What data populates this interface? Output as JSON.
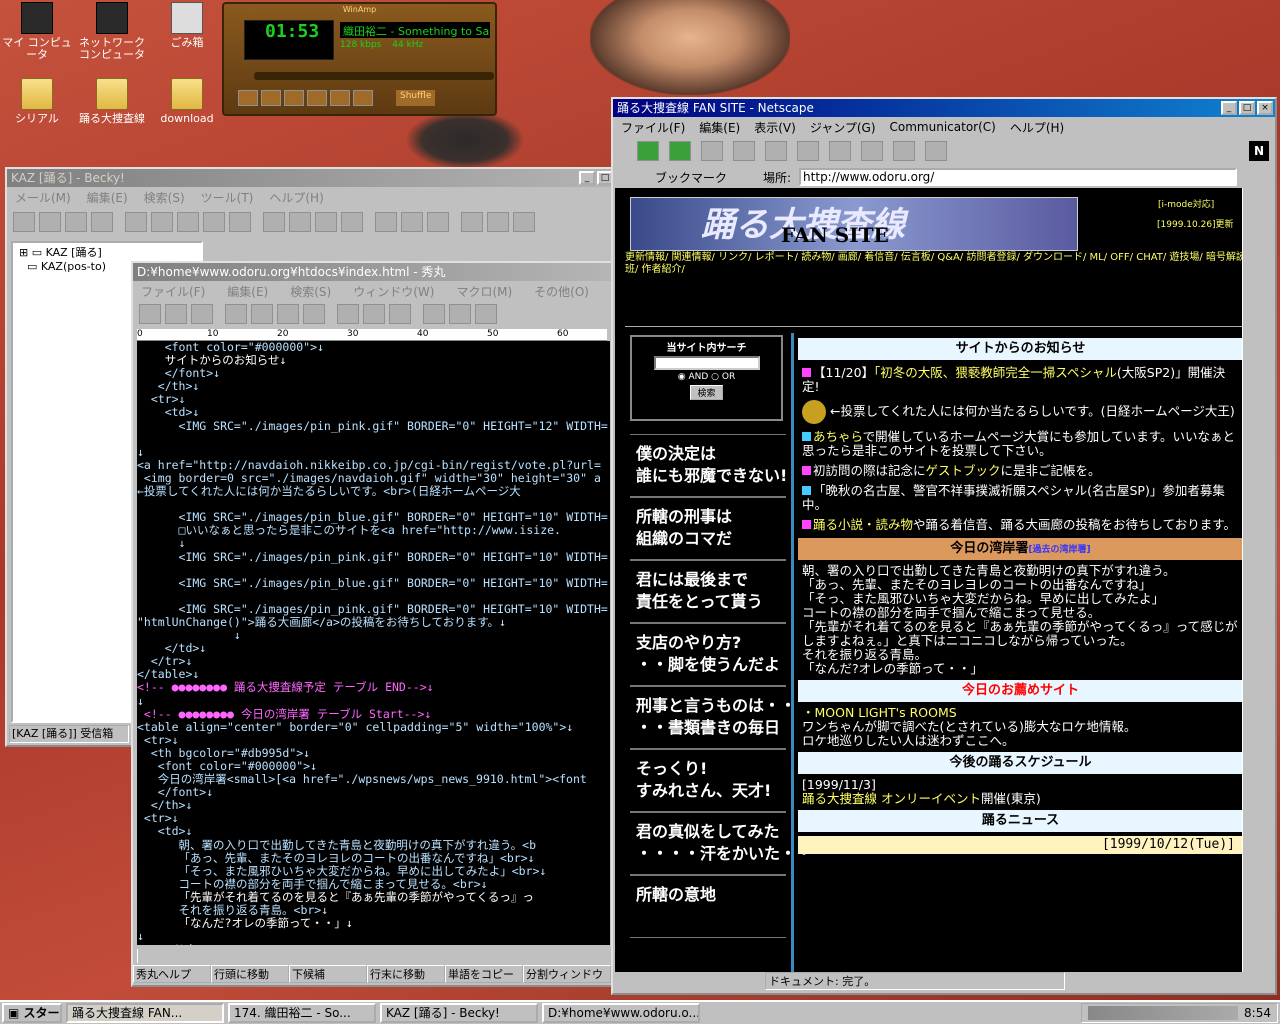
{
  "desktop": {
    "icons": [
      {
        "label": "マイ コンピュータ",
        "kind": "pc"
      },
      {
        "label": "ネットワーク コンピュータ",
        "kind": "pc"
      },
      {
        "label": "ごみ箱",
        "kind": "trash"
      },
      {
        "label": "シリアル",
        "kind": "folder"
      },
      {
        "label": "踊る大捜査線",
        "kind": "folder"
      },
      {
        "label": "download",
        "kind": "folder"
      }
    ]
  },
  "winamp": {
    "title": "WinAmp",
    "time": "01:53",
    "track": "織田裕二 - Something to Say",
    "kbps": "128",
    "khz": "44",
    "shuffle": "Shuffle"
  },
  "becky": {
    "title": "KAZ [踊る] - Becky!",
    "menu": [
      "メール(M)",
      "編集(E)",
      "検索(S)",
      "ツール(T)",
      "ヘルプ(H)"
    ],
    "tree": [
      "KAZ [踊る]",
      "KAZ(pos-to)"
    ],
    "status": "[KAZ [踊る]] 受信箱"
  },
  "hidemaru": {
    "title": "D:¥home¥www.odoru.org¥htdocs¥index.html  - 秀丸",
    "menu": [
      "ファイル(F)",
      "編集(E)",
      "検索(S)",
      "ウィンドウ(W)",
      "マクロ(M)",
      "その他(O)"
    ],
    "ruler": [
      "0",
      "10",
      "20",
      "30",
      "40",
      "50",
      "60"
    ],
    "lines": [
      "    <font color=\"#000000\">↓",
      "    サイトからのお知らせ↓",
      "    </font>↓",
      "   </th>↓",
      "  <tr>↓",
      "    <td>↓",
      "      <IMG SRC=\"./images/pin_pink.gif\" BORDER=\"0\" HEIGHT=\"12\" WIDTH=",
      "",
      "↓",
      "<a href=\"http://navdaioh.nikkeibp.co.jp/cgi-bin/regist/vote.pl?url=",
      " <img border=0 src=\"./images/navdaioh.gif\" width=\"30\" height=\"30\" a",
      "←投票してくれた人には何か当たるらしいです。<br>(日経ホームページ大",
      "",
      "      <IMG SRC=\"./images/pin_blue.gif\" BORDER=\"0\" HEIGHT=\"10\" WIDTH=",
      "      □いいなぁと思ったら是非このサイトを<a href=\"http://www.isize.",
      "      ↓",
      "      <IMG SRC=\"./images/pin_pink.gif\" BORDER=\"0\" HEIGHT=\"10\" WIDTH=",
      "",
      "      <IMG SRC=\"./images/pin_blue.gif\" BORDER=\"0\" HEIGHT=\"10\" WIDTH=",
      "",
      "      <IMG SRC=\"./images/pin_pink.gif\" BORDER=\"0\" HEIGHT=\"10\" WIDTH=",
      "\"htmlUnChange()\">踊る大画廊</a>の投稿をお待ちしております。↓",
      "              ↓",
      "    </td>↓",
      "  </tr>↓",
      "</table>↓",
      "<!-- ●●●●●●●● 踊る大捜査線予定 テーブル END-->↓",
      "↓",
      " <!-- ●●●●●●●● 今日の湾岸署 テーブル Start-->↓",
      "<table align=\"center\" border=\"0\" cellpadding=\"5\" width=\"100%\">↓",
      " <tr>↓",
      "  <th bgcolor=\"#db995d\">↓",
      "   <font color=\"#000000\">↓",
      "   今日の湾岸署<small>[<a href=\"./wpsnews/wps_news_9910.html\"><font",
      "   </font>↓",
      "  </th>↓",
      " <tr>↓",
      "   <td>↓",
      "      朝、署の入り口で出勤してきた青島と夜勤明けの真下がすれ違う。<b",
      "      「あっ、先輩、またそのヨレヨレのコートの出番なんですね」<br>↓",
      "      「そっ、また風邪ひいちゃ大変だからね。早めに出してみたよ」<br>↓",
      "      コートの襟の部分を両手で掴んで縮こまって見せる。<br>↓",
      "      「先輩がそれ着てるのを見ると『あぁ先輩の季節がやってくるっ』っ",
      "      それを振り返る青島。<br>↓",
      "      「なんだ?オレの季節って・・」↓",
      "↓",
      "    </td>↓",
      "  </tr>↓"
    ],
    "fkeys": [
      "秀丸ヘルプ",
      "行頭に移動",
      "下候補",
      "行末に移動",
      "単語をコピー",
      "分割ウィンドウ切り"
    ]
  },
  "netscape": {
    "title": "踊る大捜査線 FAN SITE - Netscape",
    "menu": [
      "ファイル(F)",
      "編集(E)",
      "表示(V)",
      "ジャンプ(G)",
      "Communicator(C)",
      "ヘルプ(H)"
    ],
    "bookmark": "ブックマーク",
    "location_label": "場所:",
    "url": "http://www.odoru.org/",
    "status": "ドキュメント: 完了。",
    "page": {
      "logo": "踊る大捜査線",
      "logo_sub": "FAN SITE",
      "imode": "[i-mode対応]",
      "updated": "[1999.10.26]更新",
      "navlinks": "更新情報/ 関連情報/ リンク/ レポート/ 読み物/ 画廊/ 着信音/ 伝言板/ Q&A/ 訪問者登録/ ダウンロード/ ML/ OFF/ CHAT/ 遊技場/ 暗号解読班/ 作者紹介/",
      "search_title": "当サイト内サーチ",
      "and": "AND",
      "or": "OR",
      "search_btn": "検索",
      "banners": [
        "僕の決定は\n誰にも邪魔できない!",
        "所轄の刑事は\n組織のコマだ",
        "君には最後まで\n責任をとって貰う",
        "支店のやり方?\n・・脚を使うんだよ",
        "刑事と言うものは・・\n・・書類書きの毎日",
        "そっくり!\nすみれさん、天才!",
        "君の真似をしてみた\n・・・・汗をかいた・・",
        "所轄の意地"
      ],
      "notice_title": "サイトからのお知らせ",
      "notices": [
        {
          "color": "#ff44ff",
          "pre": "【11/20】",
          "link": "「初冬の大阪、猥褻教師完全一掃スペシャル",
          "post": "(大阪SP2)」開催決定!"
        },
        {
          "color": "",
          "pre": "",
          "link": "",
          "post": "←投票してくれた人には何か当たるらしいです。(日経ホームページ大王)"
        },
        {
          "color": "#44ccff",
          "pre": "",
          "link": "あちゃら",
          "post": "で開催しているホームページ大賞にも参加しています。いいなぁと思ったら是非このサイトを投票して下さい。"
        },
        {
          "color": "#ff44ff",
          "pre": "初訪問の際は記念に",
          "link": "ゲストブック",
          "post": "に是非ご記帳を。"
        },
        {
          "color": "#44ccff",
          "pre": "「晩秋の名古屋、警官不祥事撲滅祈願スペシャル(名古屋SP)」参加者募集中。",
          "link": "",
          "post": ""
        },
        {
          "color": "#ff44ff",
          "pre": "",
          "link": "踊る小説・読み物",
          "post": "や踊る着信音、踊る大画廊の投稿をお待ちしております。"
        }
      ],
      "wangan_title": "今日の湾岸署",
      "wangan_link": "[過去の湾岸署]",
      "wangan_text": [
        "朝、署の入り口で出勤してきた青島と夜勤明けの真下がすれ違う。",
        "「あっ、先輩、またそのヨレヨレのコートの出番なんですね」",
        "「そっ、また風邪ひいちゃ大変だからね。早めに出してみたよ」",
        "コートの襟の部分を両手で掴んで縮こまって見せる。",
        "「先輩がそれ着てるのを見ると『あぁ先輩の季節がやってくるっ』って感じがしますよねぇ。」と真下はニコニコしながら帰っていった。",
        "それを振り返る青島。",
        "「なんだ?オレの季節って・・」"
      ],
      "reco_title": "今日のお薦めサイト",
      "reco_link": "・MOON LIGHT's ROOMS",
      "reco_text": [
        "ワンちゃんが脚で調べた(とされている)膨大なロケ地情報。",
        "ロケ地巡りしたい人は迷わずここへ。"
      ],
      "sched_title": "今後の踊るスケジュール",
      "sched_date": "[1999/11/3]",
      "sched_link": "踊る大捜査線 オンリーイベント",
      "sched_post": "開催(東京)",
      "news_title": "踊るニュース",
      "news_date": "[1999/10/12(Tue)]"
    }
  },
  "taskbar": {
    "start": "スタート",
    "buttons": [
      "踊る大捜査線 FAN...",
      "174. 織田裕二 - So...",
      "KAZ [踊る] - Becky!",
      "D:¥home¥www.odoru.o..."
    ],
    "clock": "8:54"
  },
  "colors": {
    "winamp_green": "#1cd01c",
    "wangan_bar": "#db995d",
    "reco_red": "#ff0000"
  }
}
